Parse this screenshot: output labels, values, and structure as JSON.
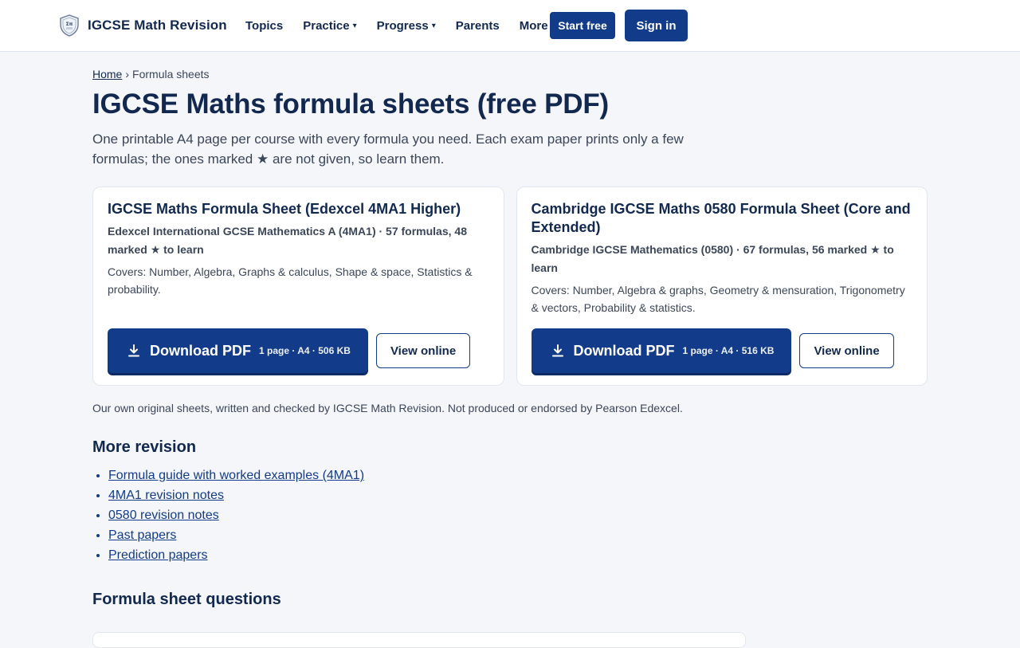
{
  "header": {
    "brand_name": "IGCSE Math Revision",
    "logo_icon": "shield-logo-icon",
    "nav": [
      {
        "label": "Topics",
        "has_dropdown": false
      },
      {
        "label": "Practice",
        "has_dropdown": true
      },
      {
        "label": "Progress",
        "has_dropdown": true
      },
      {
        "label": "Parents",
        "has_dropdown": false
      },
      {
        "label": "More",
        "has_dropdown": true
      }
    ],
    "dropdown_glyph": "▾",
    "start_label": "Start free",
    "signin_label": "Sign in"
  },
  "breadcrumb": {
    "home": "Home",
    "separator": "›",
    "current": "Formula sheets"
  },
  "page": {
    "title": "IGCSE Maths formula sheets (free PDF)",
    "lead": "One printable A4 page per course with every formula you need. Each exam paper prints only a few formulas; the ones marked ★ are not given, so learn them."
  },
  "cards": [
    {
      "title": "IGCSE Maths Formula Sheet (Edexcel 4MA1 Higher)",
      "meta": "Edexcel International GCSE Mathematics A (4MA1) · 57 formulas, 48 marked ★ to learn",
      "covers": "Covers: Number, Algebra, Graphs & calculus, Shape & space, Statistics & probability.",
      "download_label": "Download PDF",
      "download_meta": "1 page · A4 · 506 KB",
      "view_label": "View online"
    },
    {
      "title": "Cambridge IGCSE Maths 0580 Formula Sheet (Core and Extended)",
      "meta": "Cambridge IGCSE Mathematics (0580) · 67 formulas, 56 marked ★ to learn",
      "covers": "Covers: Number, Algebra & graphs, Geometry & mensuration, Trigonometry & vectors, Probability & statistics.",
      "download_label": "Download PDF",
      "download_meta": "1 page · A4 · 516 KB",
      "view_label": "View online"
    }
  ],
  "disclaimer": "Our own original sheets, written and checked by IGCSE Math Revision. Not produced or endorsed by Pearson Edexcel.",
  "more_revision": {
    "heading": "More revision",
    "links": [
      "Formula guide with worked examples (4MA1)",
      "4MA1 revision notes",
      "0580 revision notes",
      "Past papers",
      "Prediction papers"
    ]
  },
  "questions": {
    "heading": "Formula sheet questions"
  },
  "colors": {
    "primary": "#123b8a",
    "heading": "#12284f",
    "body_text": "#3b4658",
    "page_bg": "#f4f6fa",
    "card_bg": "#ffffff"
  }
}
